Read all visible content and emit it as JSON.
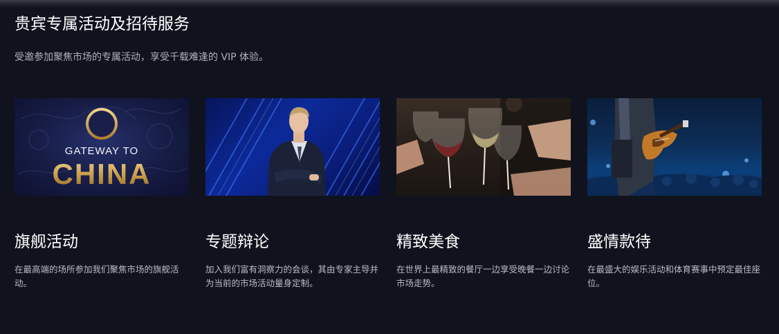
{
  "section": {
    "title": "贵宾专属活动及招待服务",
    "subtitle": "受邀参加聚焦市场的专属活动，享受千载难逢的 VIP 体验。"
  },
  "cards": [
    {
      "title": "旗舰活动",
      "description": "在最高端的场所参加我们聚焦市场的旗舰活动。",
      "image": {
        "line1": "GATEWAY TO",
        "line2": "CHINA"
      }
    },
    {
      "title": "专题辩论",
      "description": "加入我们富有洞察力的会谈，其由专家主导并为当前的市场活动量身定制。"
    },
    {
      "title": "精致美食",
      "description": "在世界上最精致的餐厅一边享受晚餐一边讨论市场走势。"
    },
    {
      "title": "盛情款待",
      "description": "在最盛大的娱乐活动和体育赛事中预定最佳座位。"
    }
  ],
  "colors": {
    "background": "#10131e",
    "text": "#ffffff",
    "muted": "#b9bcc6",
    "gold": "#c9a55c"
  }
}
